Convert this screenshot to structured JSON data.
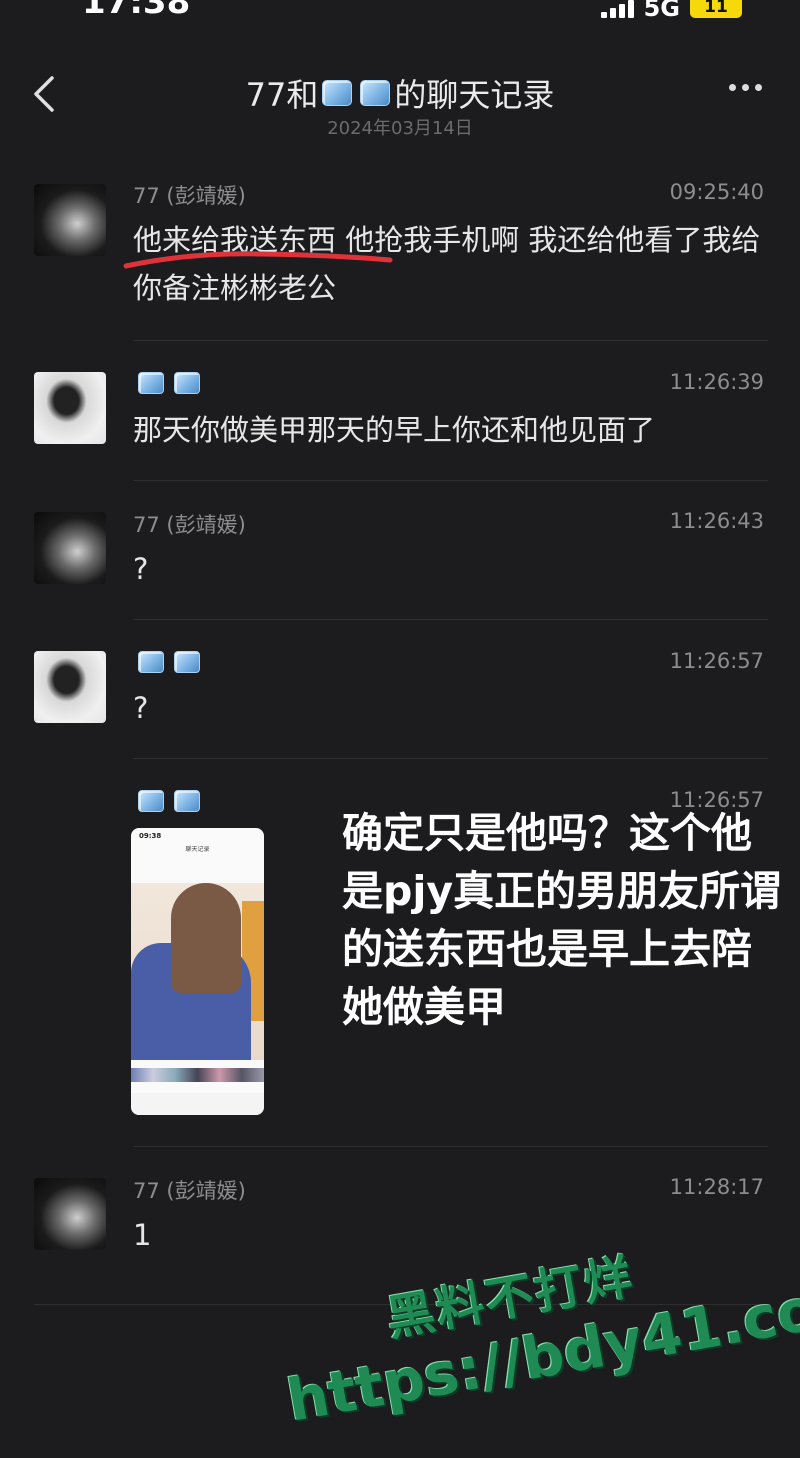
{
  "status_bar": {
    "time": "17:38",
    "network": "5G",
    "battery": "11"
  },
  "header": {
    "title_prefix": "77和",
    "title_suffix": "的聊天记录",
    "date": "2024年03月14日"
  },
  "messages": [
    {
      "sender": "77 (彭靖媛)",
      "time": "09:25:40",
      "text": "他来给我送东西 他抢我手机啊 我还给他看了我给你备注彬彬老公"
    },
    {
      "sender": "",
      "time": "11:26:39",
      "text": "那天你做美甲那天的早上你还和他见面了"
    },
    {
      "sender": "77 (彭靖媛)",
      "time": "11:26:43",
      "text": "?"
    },
    {
      "sender": "",
      "time": "11:26:57",
      "text": "?"
    },
    {
      "sender": "",
      "time": "11:26:57",
      "text": ""
    },
    {
      "sender": "77 (彭靖媛)",
      "time": "11:28:17",
      "text": "1"
    }
  ],
  "overlay_text": "确定只是他吗？这个他是pjy真正的男朋友所谓的送东西也是早上去陪她做美甲",
  "watermark": {
    "line1": "黑料不打烊",
    "line2": "https://bdy41.co"
  },
  "thumbnail": {
    "status_time": "09:38",
    "title": "聊天记录"
  },
  "colors": {
    "background": "#1c1c1e",
    "annotation_red": "#e0323a",
    "watermark_green": "#1f8a54"
  }
}
